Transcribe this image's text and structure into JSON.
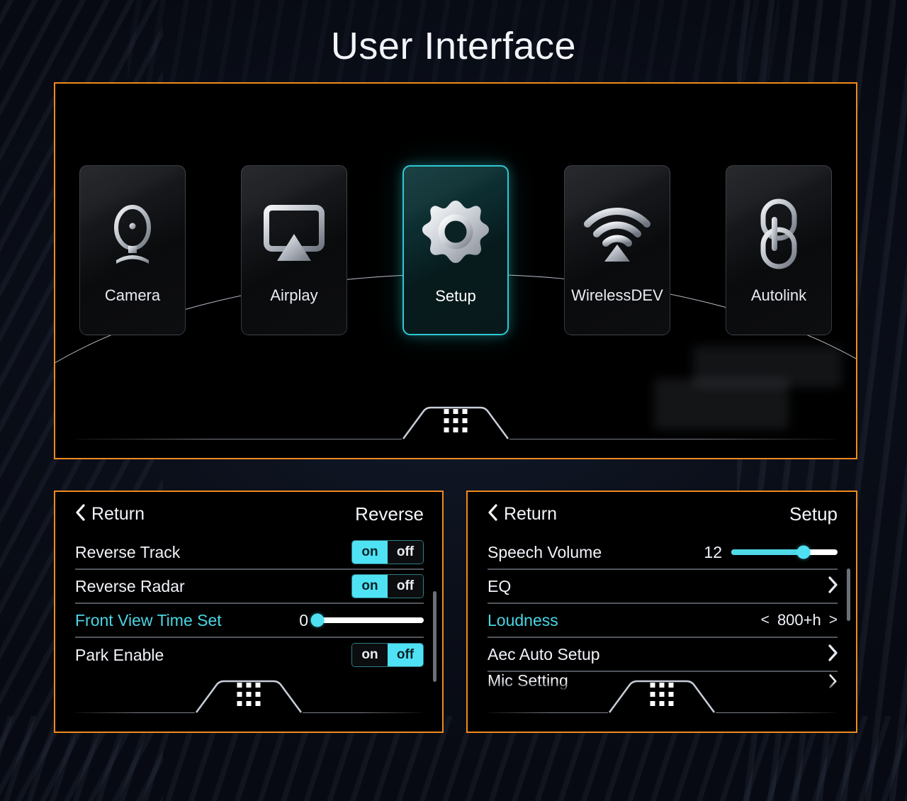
{
  "page": {
    "title": "User Interface",
    "accent_orange": "#f08a1e",
    "accent_cyan": "#4fe2f4",
    "selected_tile_border": "#2fc9d2"
  },
  "home_screen": {
    "tiles": [
      {
        "label": "Camera",
        "icon": "camera-icon",
        "selected": false
      },
      {
        "label": "Airplay",
        "icon": "airplay-icon",
        "selected": false
      },
      {
        "label": "Setup",
        "icon": "gear-icon",
        "selected": true
      },
      {
        "label": "WirelessDEV",
        "icon": "wifi-icon",
        "selected": false
      },
      {
        "label": "Autolink",
        "icon": "link-icon",
        "selected": false
      }
    ],
    "dock": {
      "icon": "apps-grid-icon"
    }
  },
  "reverse_screen": {
    "return_label": "Return",
    "return_icon": "chevron-left-icon",
    "title": "Reverse",
    "dock": {
      "icon": "apps-grid-icon"
    },
    "rows": [
      {
        "label": "Reverse Track",
        "control": "toggle",
        "on_label": "on",
        "off_label": "off",
        "value": "on",
        "active": false
      },
      {
        "label": "Reverse Radar",
        "control": "toggle",
        "on_label": "on",
        "off_label": "off",
        "value": "on",
        "active": false
      },
      {
        "label": "Front View Time Set",
        "control": "slider",
        "value": "0",
        "percent": 0,
        "active": true
      },
      {
        "label": "Park Enable",
        "control": "toggle",
        "on_label": "on",
        "off_label": "off",
        "value": "off",
        "active": false
      }
    ]
  },
  "setup_screen": {
    "return_label": "Return",
    "return_icon": "chevron-left-icon",
    "title": "Setup",
    "dock": {
      "icon": "apps-grid-icon"
    },
    "rows": [
      {
        "label": "Speech Volume",
        "control": "slider",
        "value": "12",
        "percent": 68,
        "active": false
      },
      {
        "label": "EQ",
        "control": "chevron",
        "icon": "chevron-right-icon",
        "active": false
      },
      {
        "label": "Loudness",
        "control": "stepper",
        "prev_icon": "<",
        "next_icon": ">",
        "value": "800+h",
        "active": true
      },
      {
        "label": "Aec Auto Setup",
        "control": "chevron",
        "icon": "chevron-right-icon",
        "active": false
      },
      {
        "label": "Mic Setting",
        "control": "chevron",
        "icon": "chevron-right-icon",
        "active": false,
        "clipped": true
      }
    ]
  }
}
